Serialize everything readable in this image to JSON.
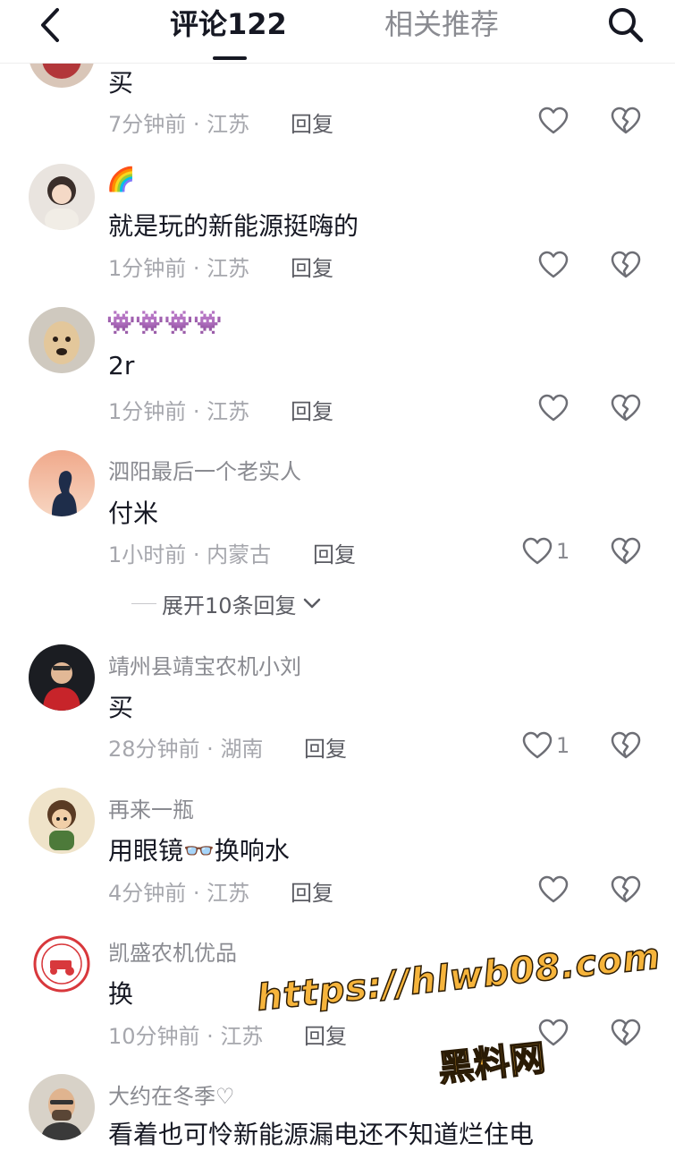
{
  "header": {
    "tab_comments": "评论122",
    "tab_related": "相关推荐"
  },
  "comments": [
    {
      "username": "",
      "content": "买",
      "time": "7分钟前",
      "location": "江苏",
      "reply": "回复",
      "likes": ""
    },
    {
      "username": "🌈",
      "content": "就是玩的新能源挺嗨的",
      "time": "1分钟前",
      "location": "江苏",
      "reply": "回复",
      "likes": ""
    },
    {
      "username": "👾👾👾👾",
      "content": "2r",
      "time": "1分钟前",
      "location": "江苏",
      "reply": "回复",
      "likes": ""
    },
    {
      "username": "泗阳最后一个老实人",
      "content": "付米",
      "time": "1小时前",
      "location": "内蒙古",
      "reply": "回复",
      "likes": "1",
      "expand": "展开10条回复"
    },
    {
      "username": "靖州县靖宝农机小刘",
      "content": "买",
      "time": "28分钟前",
      "location": "湖南",
      "reply": "回复",
      "likes": "1"
    },
    {
      "username": "再来一瓶",
      "content": "用眼镜👓换响水",
      "time": "4分钟前",
      "location": "江苏",
      "reply": "回复",
      "likes": ""
    },
    {
      "username": "凯盛农机优品",
      "content": "换",
      "time": "10分钟前",
      "location": "江苏",
      "reply": "回复",
      "likes": ""
    },
    {
      "username": "大约在冬季♡",
      "content": "看着也可怜新能源漏电还不知道烂住电",
      "time": "",
      "location": "",
      "reply": "",
      "likes": ""
    }
  ],
  "meta_separator": " · ",
  "watermark": {
    "url": "https://hlwb08.com",
    "name": "黑料网"
  },
  "colors": {
    "text_primary": "#161823",
    "text_secondary": "#8a8b91",
    "watermark": "#f6b43b"
  },
  "icons": {
    "back": "chevron-left-icon",
    "search": "search-icon",
    "like": "heart-outline-icon",
    "dislike": "broken-heart-icon",
    "expand": "chevron-down-icon"
  }
}
